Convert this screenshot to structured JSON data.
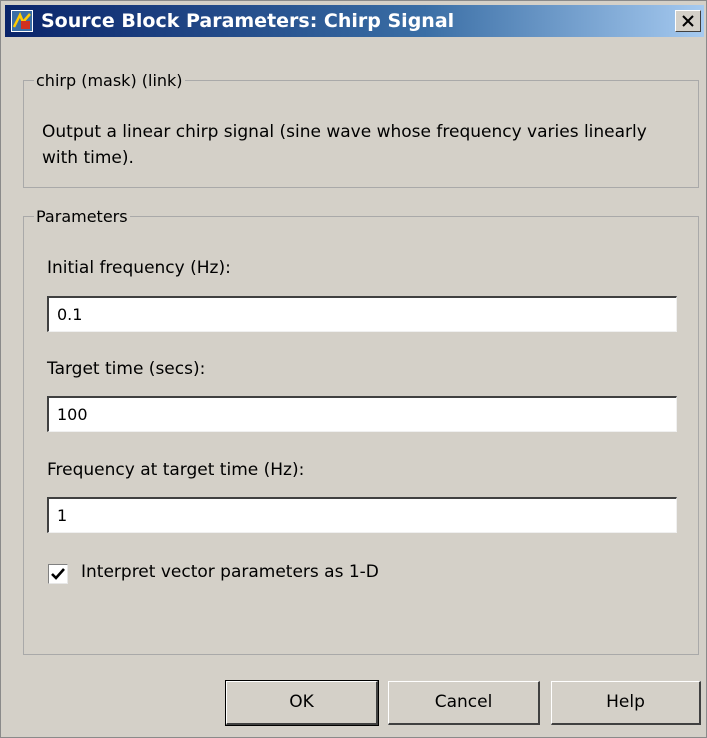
{
  "window": {
    "title": "Source Block Parameters: Chirp Signal",
    "app_icon": "simulink-block-icon",
    "close_icon": "close-x-icon"
  },
  "description_group": {
    "legend": "chirp (mask) (link)",
    "text": "Output a linear chirp signal (sine wave  whose frequency varies linearly with time)."
  },
  "parameters_group": {
    "legend": "Parameters",
    "initial_frequency": {
      "label": "Initial frequency (Hz):",
      "value": "0.1"
    },
    "target_time": {
      "label": "Target time (secs):",
      "value": "100"
    },
    "frequency_at_target": {
      "label": "Frequency at target time (Hz):",
      "value": "1"
    },
    "interpret_vector": {
      "label": "Interpret vector parameters as 1-D",
      "checked": true
    }
  },
  "buttons": {
    "ok": "OK",
    "cancel": "Cancel",
    "help": "Help"
  }
}
